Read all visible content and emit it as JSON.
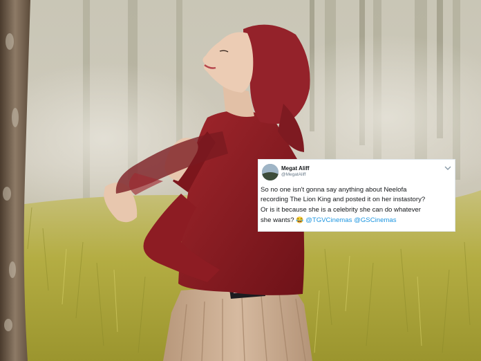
{
  "tweet": {
    "display_name": "Megat Aliff",
    "handle": "@MegatAliff",
    "text_line1": "So no one isn't gonna say anything about Neelofa",
    "text_line2": "recording The Lion King and posted it on her instastory?",
    "text_line3": "Or is it because she is a celebrity she can do whatever",
    "text_line4": "she wants?",
    "emoji": "😂",
    "mention_1": "@TGVCinemas",
    "mention_2": "@GSCinemas"
  },
  "icons": {
    "avatar": "landscape-avatar-icon",
    "menu": "chevron-down-icon"
  },
  "colors": {
    "mention": "#1b95e0",
    "scarf": "#8e1a22",
    "skirt": "#c9a98b",
    "grass": "#b8b23c"
  }
}
